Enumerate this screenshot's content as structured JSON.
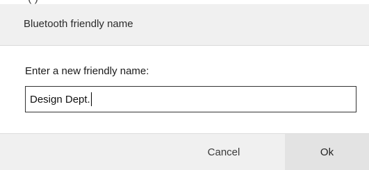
{
  "background_window": {
    "partial_text": "(                          )"
  },
  "dialog": {
    "title": "Bluetooth friendly name",
    "prompt_label": "Enter a new friendly name:",
    "name_input": {
      "value": "Design Dept."
    },
    "buttons": {
      "cancel_label": "Cancel",
      "ok_label": "Ok"
    }
  },
  "colors": {
    "header_background": "#f0f0f0",
    "footer_background": "#f0f0f0",
    "ok_button_background": "#e3e3e3",
    "input_border": "#333333"
  }
}
